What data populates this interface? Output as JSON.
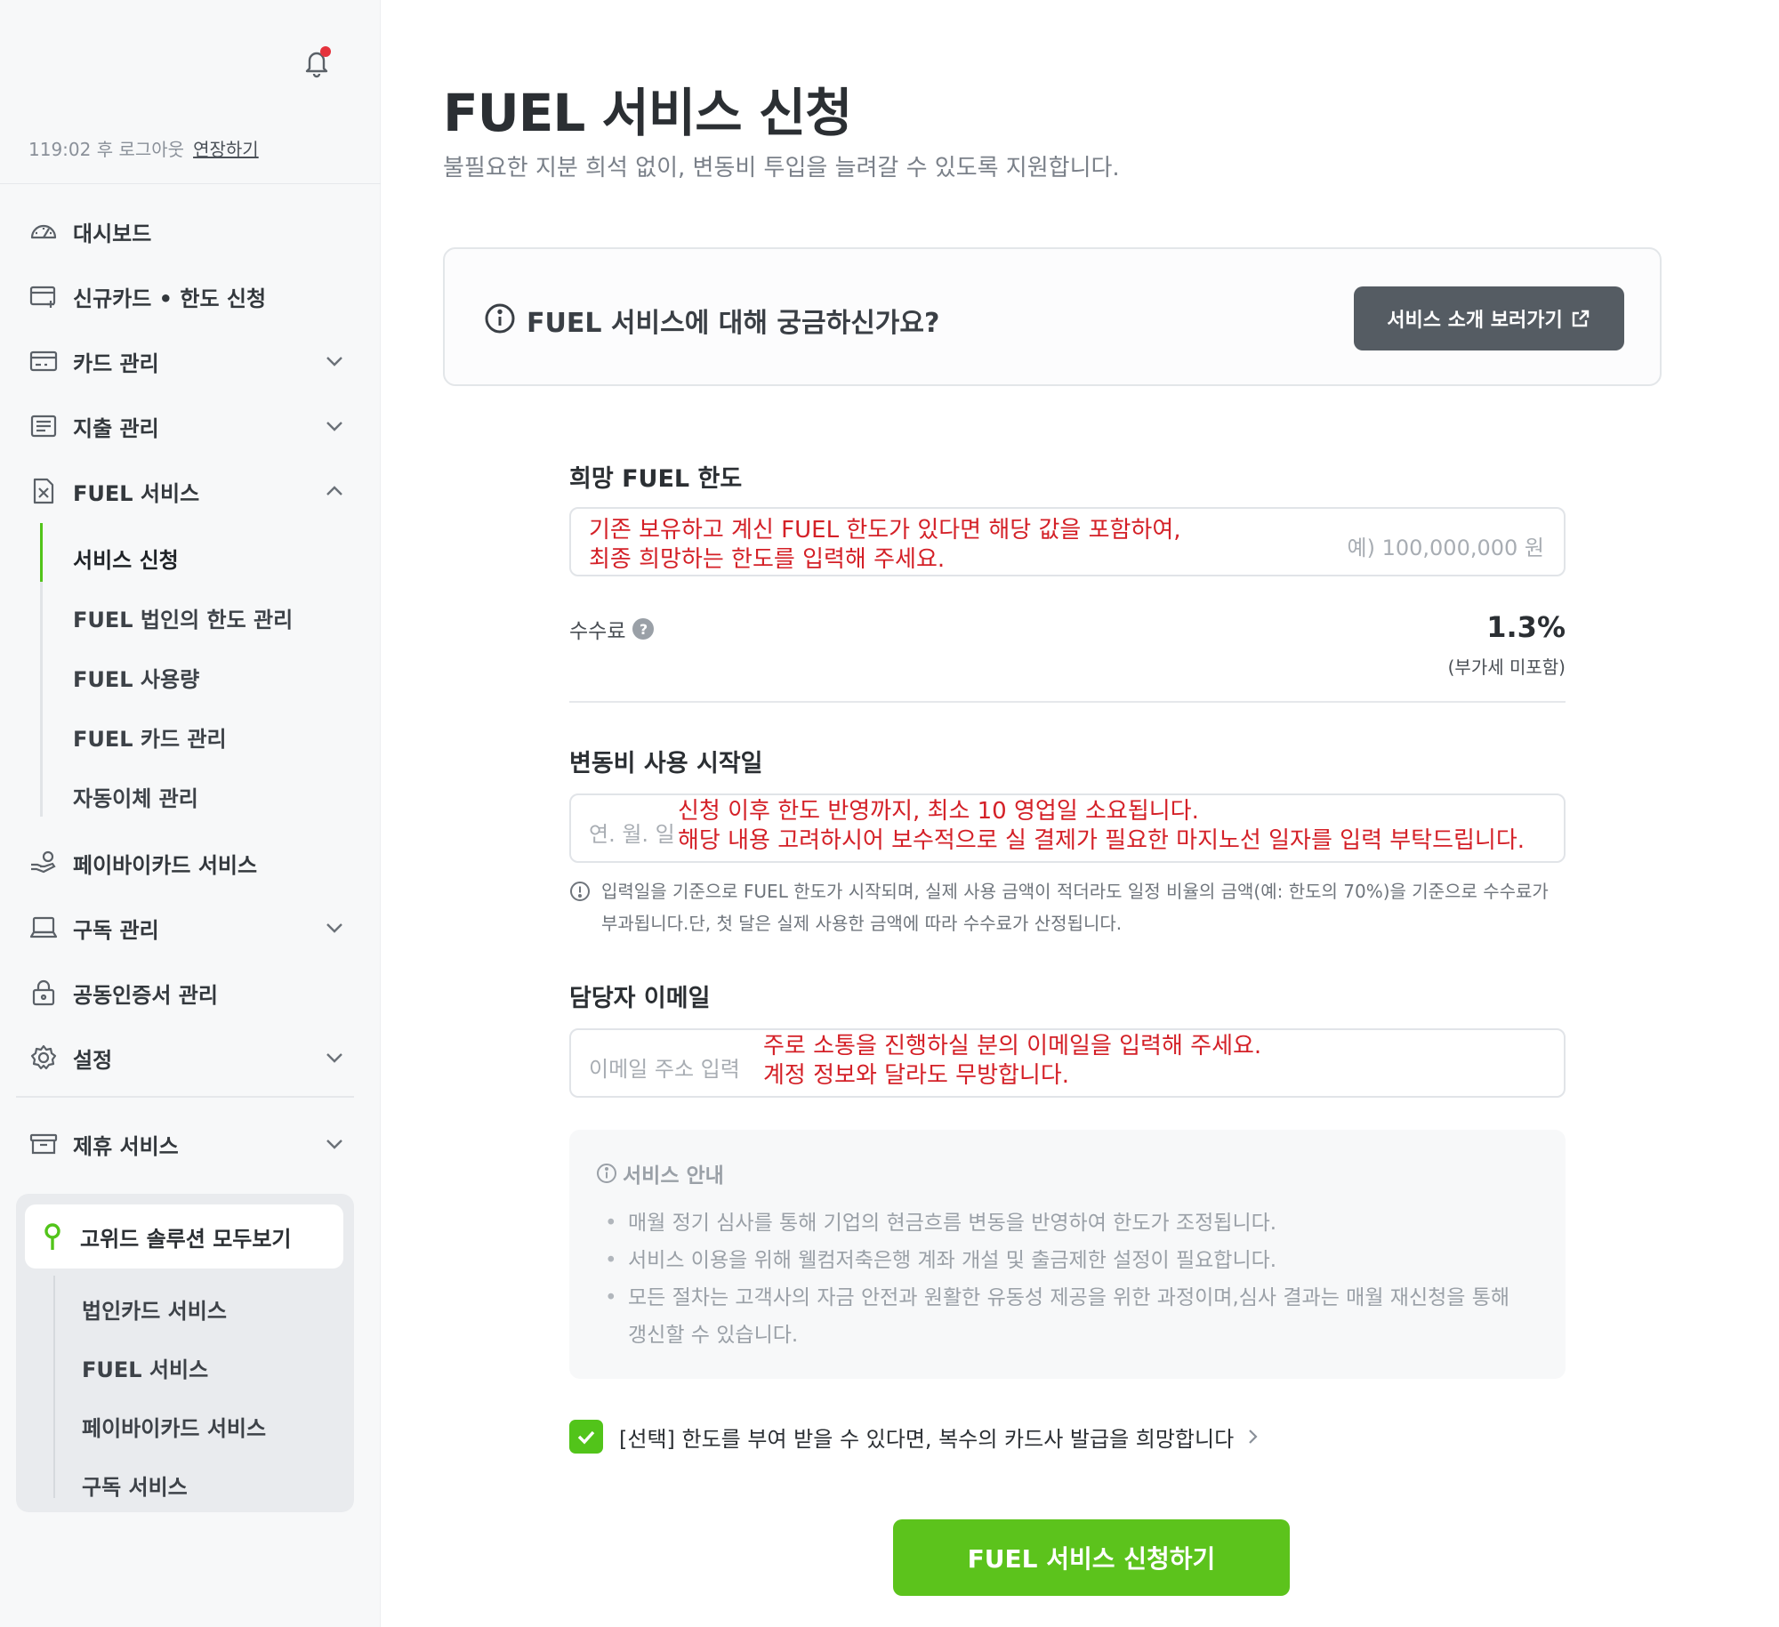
{
  "sidebar": {
    "session_timer": "119:02 후 로그아웃",
    "extend_label": "연장하기",
    "items": [
      {
        "label": "대시보드",
        "icon": "speedometer-icon"
      },
      {
        "label": "신규카드 • 한도 신청",
        "icon": "card-add-icon"
      },
      {
        "label": "카드 관리",
        "icon": "card-icon"
      },
      {
        "label": "지출 관리",
        "icon": "receipt-icon"
      },
      {
        "label": "FUEL 서비스",
        "icon": "fuel-icon"
      },
      {
        "label": "페이바이카드 서비스",
        "icon": "hand-coin-icon"
      },
      {
        "label": "구독 관리",
        "icon": "laptop-icon"
      },
      {
        "label": "공동인증서 관리",
        "icon": "lock-icon"
      },
      {
        "label": "설정",
        "icon": "gear-icon"
      },
      {
        "label": "제휴 서비스",
        "icon": "archive-icon"
      }
    ],
    "fuel_sub": [
      {
        "label": "서비스 신청"
      },
      {
        "label": "FUEL 법인의 한도 관리"
      },
      {
        "label": "FUEL 사용량"
      },
      {
        "label": "FUEL 카드 관리"
      },
      {
        "label": "자동이체 관리"
      }
    ],
    "solutions": {
      "title": "고위드 솔루션 모두보기",
      "items": [
        "법인카드 서비스",
        "FUEL 서비스",
        "페이바이카드 서비스",
        "구독 서비스"
      ]
    }
  },
  "main": {
    "title": "FUEL 서비스 신청",
    "subtitle": "불필요한 지분 희석 없이, 변동비 투입을 늘려갈 수 있도록 지원합니다.",
    "info_card": {
      "question": "FUEL 서비스에 대해 궁금하신가요?",
      "button": "서비스 소개 보러가기"
    },
    "limit": {
      "label": "희망 FUEL 한도",
      "placeholder": "예) 100,000,000 원",
      "annotation_line1": "기존 보유하고 계신 FUEL 한도가 있다면 해당 값을 포함하여,",
      "annotation_line2": "최종 희망하는 한도를 입력해 주세요."
    },
    "fee": {
      "label": "수수료",
      "help": "?",
      "value": "1.3%",
      "note": "(부가세 미포함)"
    },
    "start_date": {
      "label": "변동비 사용 시작일",
      "placeholder": "연. 월. 일",
      "annotation_line1": "신청 이후 한도 반영까지, 최소 10 영업일 소요됩니다.",
      "annotation_line2": "해당 내용 고려하시어 보수적으로 실 결제가 필요한 마지노선 일자를 입력 부탁드립니다.",
      "notice": "입력일을 기준으로 FUEL 한도가 시작되며, 실제 사용 금액이 적더라도 일정 비율의 금액(예: 한도의 70%)을 기준으로 수수료가 부과됩니다.단, 첫 달은 실제 사용한 금액에 따라 수수료가 산정됩니다."
    },
    "email": {
      "label": "담당자 이메일",
      "placeholder": "이메일 주소 입력",
      "annotation_line1": "주로 소통을 진행하실 분의 이메일을 입력해 주세요.",
      "annotation_line2": "계정 정보와 달라도 무방합니다."
    },
    "guide": {
      "title": "서비스 안내",
      "items": [
        "매월 정기 심사를 통해 기업의 현금흐름 변동을 반영하여 한도가 조정됩니다.",
        "서비스 이용을 위해 웰컴저축은행 계좌 개설 및 출금제한 설정이 필요합니다.",
        "모든 절차는 고객사의 자금 안전과 원활한 유동성 제공을 위한 과정이며,심사 결과는 매월 재신청을 통해 갱신할 수 있습니다."
      ]
    },
    "agree": {
      "label": "[선택] 한도를 부여 받을 수 있다면, 복수의 카드사 발급을 희망합니다",
      "checked": true
    },
    "submit": "FUEL 서비스 신청하기"
  },
  "colors": {
    "accent_green": "#5cc31c",
    "annotation_red": "#d42027",
    "dark_button": "#555c63"
  }
}
